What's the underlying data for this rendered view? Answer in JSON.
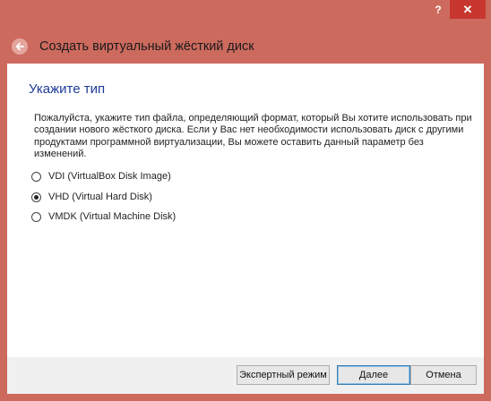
{
  "window": {
    "help_glyph": "?",
    "close_glyph": "✕"
  },
  "header": {
    "title": "Создать виртуальный жёсткий диск",
    "back_icon": "back-arrow-icon"
  },
  "main": {
    "section_title": "Укажите тип",
    "description": "Пожалуйста, укажите тип файла, определяющий формат, который Вы хотите использовать при создании нового жёсткого диска. Если у Вас нет необходимости использовать диск с другими продуктами программной виртуализации, Вы можете оставить данный параметр без изменений.",
    "options": [
      {
        "label": "VDI (VirtualBox Disk Image)",
        "checked": false
      },
      {
        "label": "VHD (Virtual Hard Disk)",
        "checked": true
      },
      {
        "label": "VMDK (Virtual Machine Disk)",
        "checked": false
      }
    ]
  },
  "footer": {
    "expert_label": "Экспертный режим",
    "next_label": "Далее",
    "cancel_label": "Отмена"
  },
  "colors": {
    "frame": "#cd6a5e",
    "close": "#c7372f",
    "section_title": "#1f3b99"
  }
}
